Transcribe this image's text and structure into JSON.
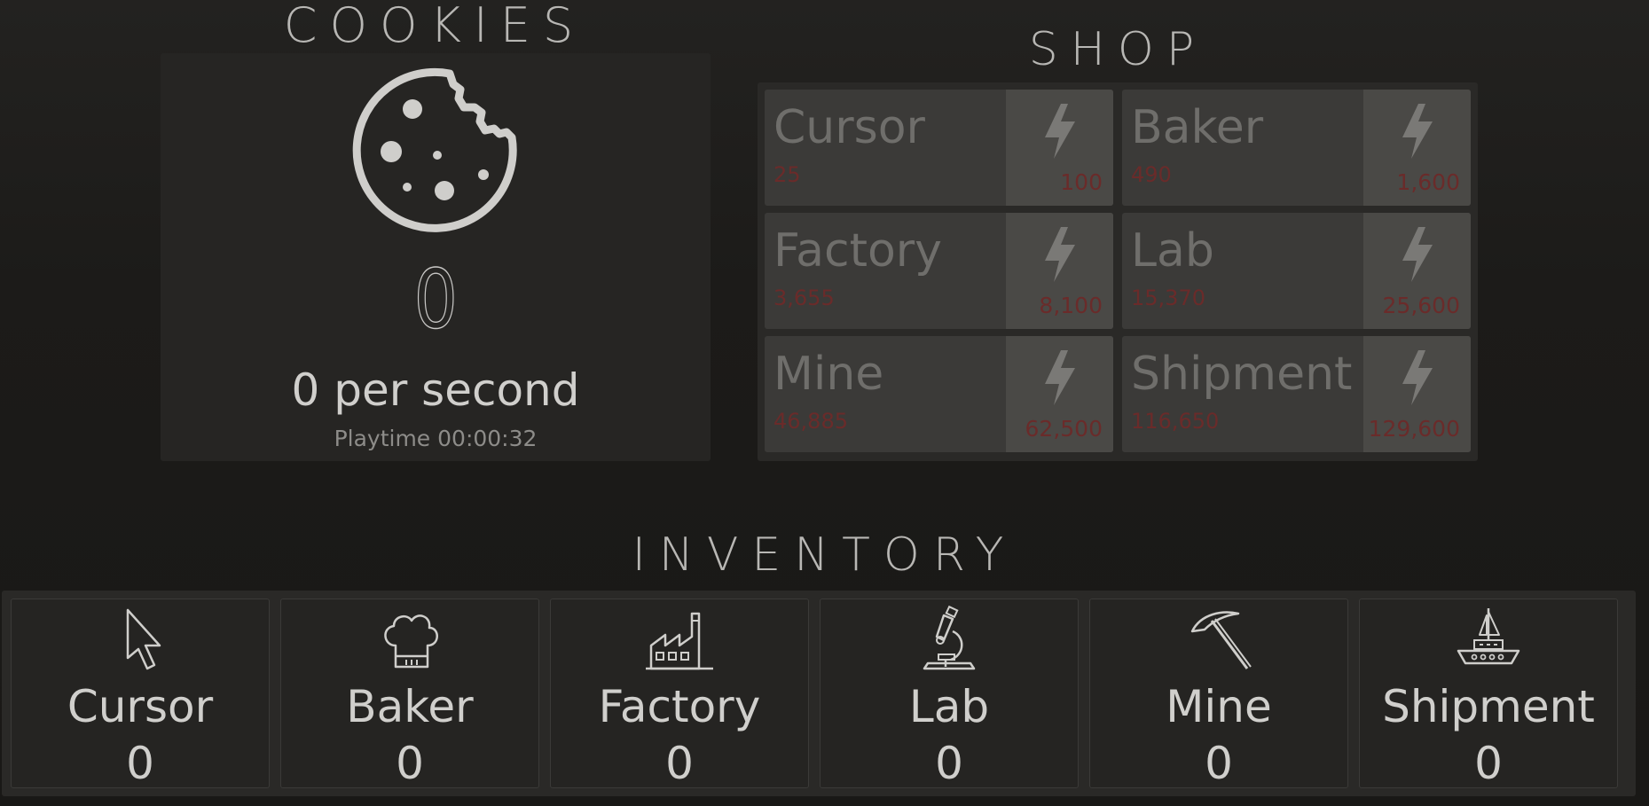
{
  "colors": {
    "background": "#1c1b19",
    "panel": "#262523",
    "shop_item": "#3b3a38",
    "shop_item_side": "#4a4946",
    "price_red": "#6a2b2a",
    "text_light": "#d0cfcc",
    "text_dim": "#6f6e6b",
    "icon_light": "#cfcecb"
  },
  "cookies": {
    "title": "COOKIES",
    "count": "0",
    "rate": "0 per second",
    "playtime": "Playtime 00:00:32",
    "icon": "cookie-icon"
  },
  "shop": {
    "title": "SHOP",
    "items": [
      {
        "name": "Cursor",
        "price": "25",
        "power": "100",
        "icon": "lightning-bolt-icon"
      },
      {
        "name": "Baker",
        "price": "490",
        "power": "1,600",
        "icon": "lightning-bolt-icon"
      },
      {
        "name": "Factory",
        "price": "3,655",
        "power": "8,100",
        "icon": "lightning-bolt-icon"
      },
      {
        "name": "Lab",
        "price": "15,370",
        "power": "25,600",
        "icon": "lightning-bolt-icon"
      },
      {
        "name": "Mine",
        "price": "46,885",
        "power": "62,500",
        "icon": "lightning-bolt-icon"
      },
      {
        "name": "Shipment",
        "price": "116,650",
        "power": "129,600",
        "icon": "lightning-bolt-icon"
      }
    ]
  },
  "inventory": {
    "title": "INVENTORY",
    "items": [
      {
        "name": "Cursor",
        "count": "0",
        "icon": "cursor-arrow-icon"
      },
      {
        "name": "Baker",
        "count": "0",
        "icon": "chef-hat-icon"
      },
      {
        "name": "Factory",
        "count": "0",
        "icon": "factory-icon"
      },
      {
        "name": "Lab",
        "count": "0",
        "icon": "microscope-icon"
      },
      {
        "name": "Mine",
        "count": "0",
        "icon": "pickaxe-icon"
      },
      {
        "name": "Shipment",
        "count": "0",
        "icon": "ship-icon"
      }
    ]
  }
}
